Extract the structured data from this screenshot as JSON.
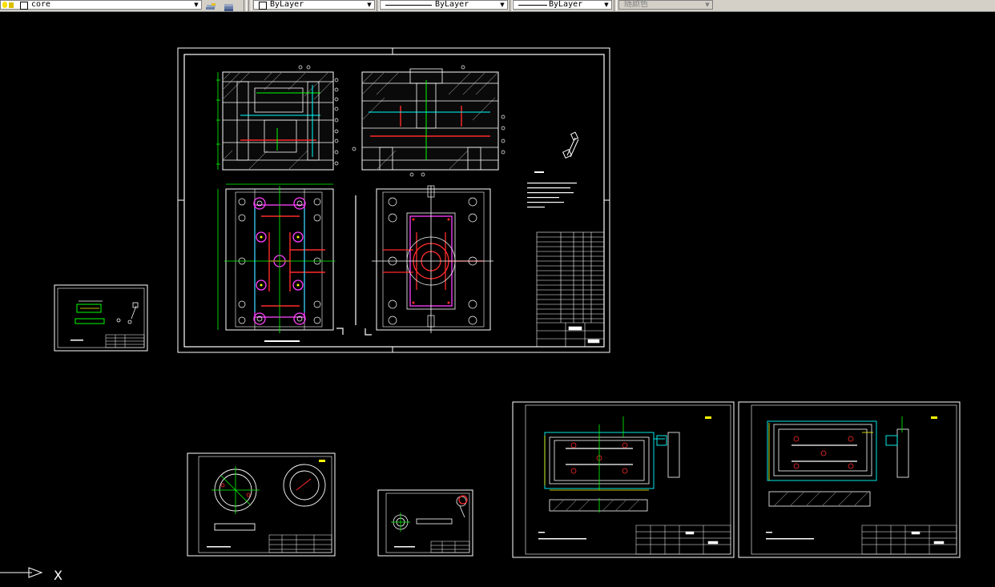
{
  "toolbar": {
    "layer": {
      "value": "core",
      "icons": [
        "lightbulb-icon",
        "sun-icon",
        "lock-icon",
        "layer-color-icon"
      ]
    },
    "layer_tools": [
      "layer-previous-icon",
      "layer-states-icon"
    ],
    "color": {
      "value": "ByLayer"
    },
    "linetype": {
      "value": "ByLayer"
    },
    "lineweight": {
      "value": "ByLayer"
    },
    "plotstyle": {
      "value": "随颜色"
    }
  },
  "drawing": {
    "background": "#000000",
    "colors": {
      "frame": "#ffffff",
      "red": "#ff2b2b",
      "magenta": "#ff40ff",
      "green": "#00ff00",
      "cyan": "#00ffff",
      "yellow": "#ffff00"
    },
    "sheets": [
      "main-assembly-sheet",
      "small-part-sheet",
      "ring-part-sheet",
      "pin-part-sheet",
      "cavity-plate-sheet",
      "core-plate-sheet"
    ]
  },
  "ucs_icon": {
    "axis_label": "X"
  }
}
